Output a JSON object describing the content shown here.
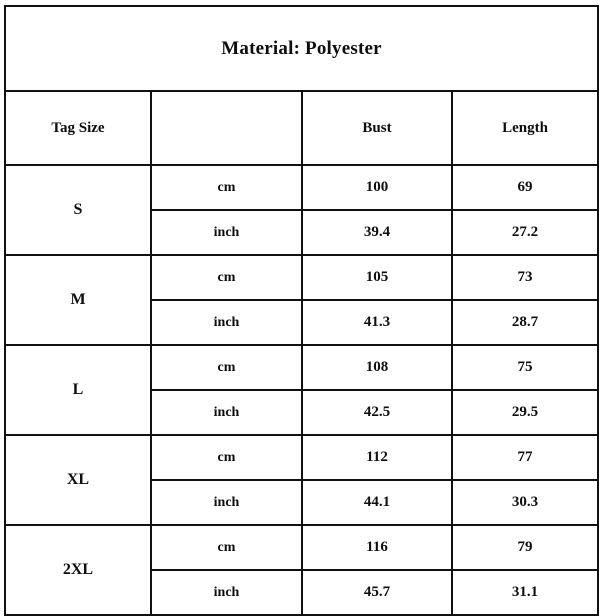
{
  "title": "Material: Polyester",
  "header": {
    "tag_size": "Tag Size",
    "unit": "",
    "bust": "Bust",
    "length": "Length"
  },
  "units": {
    "cm": "cm",
    "inch": "inch"
  },
  "colors": {
    "shaded_row": "#c0c0c0",
    "border": "#111111",
    "background": "#ffffff",
    "text": "#0e0e0e"
  },
  "chart_data": {
    "type": "table",
    "title": "Material: Polyester",
    "columns": [
      "Tag Size",
      "",
      "Bust",
      "Length"
    ],
    "rows": [
      {
        "size": "S",
        "unit": "cm",
        "bust": "100",
        "length": "69",
        "shaded": false
      },
      {
        "size": "S",
        "unit": "inch",
        "bust": "39.4",
        "length": "27.2",
        "shaded": true
      },
      {
        "size": "M",
        "unit": "cm",
        "bust": "105",
        "length": "73",
        "shaded": false
      },
      {
        "size": "M",
        "unit": "inch",
        "bust": "41.3",
        "length": "28.7",
        "shaded": true
      },
      {
        "size": "L",
        "unit": "cm",
        "bust": "108",
        "length": "75",
        "shaded": false
      },
      {
        "size": "L",
        "unit": "inch",
        "bust": "42.5",
        "length": "29.5",
        "shaded": true
      },
      {
        "size": "XL",
        "unit": "cm",
        "bust": "112",
        "length": "77",
        "shaded": false
      },
      {
        "size": "XL",
        "unit": "inch",
        "bust": "44.1",
        "length": "30.3",
        "shaded": true
      },
      {
        "size": "2XL",
        "unit": "cm",
        "bust": "116",
        "length": "79",
        "shaded": false
      },
      {
        "size": "2XL",
        "unit": "inch",
        "bust": "45.7",
        "length": "31.1",
        "shaded": true
      }
    ]
  },
  "sizes": [
    {
      "label": "S",
      "cm": {
        "unit": "cm",
        "bust": "100",
        "length": "69"
      },
      "inch": {
        "unit": "inch",
        "bust": "39.4",
        "length": "27.2"
      }
    },
    {
      "label": "M",
      "cm": {
        "unit": "cm",
        "bust": "105",
        "length": "73"
      },
      "inch": {
        "unit": "inch",
        "bust": "41.3",
        "length": "28.7"
      }
    },
    {
      "label": "L",
      "cm": {
        "unit": "cm",
        "bust": "108",
        "length": "75"
      },
      "inch": {
        "unit": "inch",
        "bust": "42.5",
        "length": "29.5"
      }
    },
    {
      "label": "XL",
      "cm": {
        "unit": "cm",
        "bust": "112",
        "length": "77"
      },
      "inch": {
        "unit": "inch",
        "bust": "44.1",
        "length": "30.3"
      }
    },
    {
      "label": "2XL",
      "cm": {
        "unit": "cm",
        "bust": "116",
        "length": "79"
      },
      "inch": {
        "unit": "inch",
        "bust": "45.7",
        "length": "31.1"
      }
    }
  ]
}
